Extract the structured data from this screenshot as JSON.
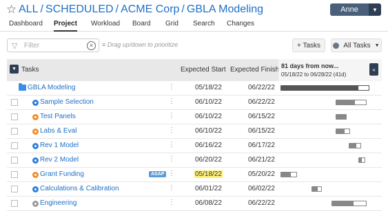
{
  "header": {
    "breadcrumb": [
      "ALL",
      "SCHEDULED",
      "ACME Corp",
      "GBLA Modeling"
    ],
    "separator": "/",
    "user": "Anne"
  },
  "nav": {
    "tabs": [
      "Dashboard",
      "Project",
      "Workload",
      "Board",
      "Grid",
      "Search",
      "Changes"
    ],
    "active": "Project"
  },
  "toolbar": {
    "filter_placeholder": "Filter",
    "hint": "Drag up/down to prioritize",
    "add_tasks": "+ Tasks",
    "all_tasks": "All Tasks"
  },
  "table": {
    "col_tasks": "Tasks",
    "col_start": "Expected Start",
    "col_finish": "Expected Finish",
    "gantt_line1": "81 days from now...",
    "gantt_line2": "05/18/22 to 06/28/22 (41d)"
  },
  "rows": [
    {
      "name": "GBLA Modeling",
      "type": "project",
      "start": "05/18/22",
      "finish": "06/22/22",
      "highlight": false,
      "badge": "",
      "bar_start": 0.02,
      "bar_end": 0.88,
      "style": "full"
    },
    {
      "name": "Sample Selection",
      "type": "task",
      "status": "blue",
      "start": "06/10/22",
      "finish": "06/22/22",
      "highlight": false,
      "badge": "",
      "bar_start": 0.55,
      "bar_end": 0.85,
      "style": "box"
    },
    {
      "name": "Test Panels",
      "type": "task",
      "status": "orange",
      "start": "06/10/22",
      "finish": "06/15/22",
      "highlight": false,
      "badge": "",
      "bar_start": 0.55,
      "bar_end": 0.66,
      "style": "solid"
    },
    {
      "name": "Labs & Eval",
      "type": "task",
      "status": "orange",
      "start": "06/10/22",
      "finish": "06/15/22",
      "highlight": false,
      "badge": "",
      "bar_start": 0.55,
      "bar_end": 0.69,
      "style": "box"
    },
    {
      "name": "Rev 1 Model",
      "type": "task",
      "status": "blue",
      "start": "06/16/22",
      "finish": "06/17/22",
      "highlight": false,
      "badge": "",
      "bar_start": 0.68,
      "bar_end": 0.8,
      "style": "box"
    },
    {
      "name": "Rev 2 Model",
      "type": "task",
      "status": "blue",
      "start": "06/20/22",
      "finish": "06/21/22",
      "highlight": false,
      "badge": "",
      "bar_start": 0.77,
      "bar_end": 0.84,
      "style": "box"
    },
    {
      "name": "Grant Funding",
      "type": "task",
      "status": "orange",
      "start": "05/18/22",
      "finish": "05/20/22",
      "highlight": true,
      "badge": "ASAP",
      "bar_start": 0.02,
      "bar_end": 0.18,
      "style": "box"
    },
    {
      "name": "Calculations & Calibration",
      "type": "task",
      "status": "blue",
      "start": "06/01/22",
      "finish": "06/02/22",
      "highlight": false,
      "badge": "",
      "bar_start": 0.32,
      "bar_end": 0.42,
      "style": "box"
    },
    {
      "name": "Engineering",
      "type": "task",
      "status": "gray",
      "start": "06/08/22",
      "finish": "06/22/22",
      "highlight": false,
      "badge": "",
      "bar_start": 0.51,
      "bar_end": 0.85,
      "style": "box"
    }
  ]
}
